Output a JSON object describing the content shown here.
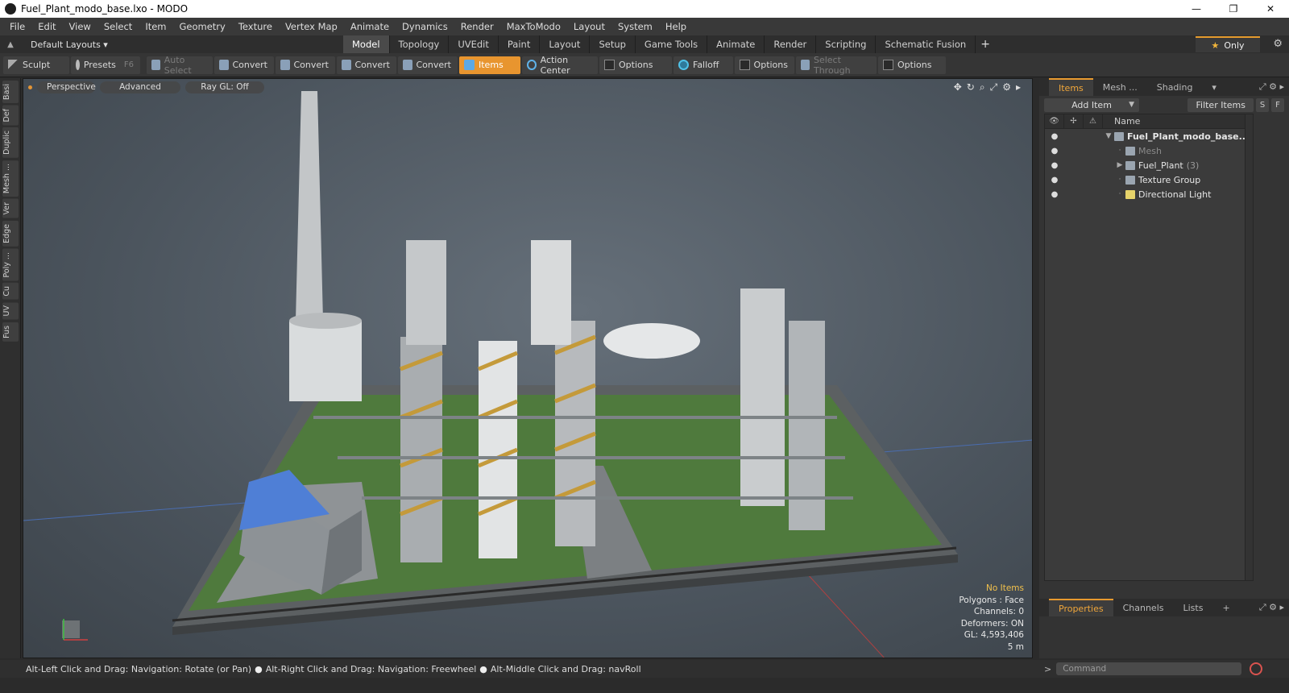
{
  "window": {
    "title": "Fuel_Plant_modo_base.lxo - MODO",
    "controls": [
      "—",
      "❐",
      "✕"
    ]
  },
  "menu": [
    "File",
    "Edit",
    "View",
    "Select",
    "Item",
    "Geometry",
    "Texture",
    "Vertex Map",
    "Animate",
    "Dynamics",
    "Render",
    "MaxToModo",
    "Layout",
    "System",
    "Help"
  ],
  "layout": {
    "layouts_label": "Default Layouts ▾",
    "tabs": [
      "Model",
      "Topology",
      "UVEdit",
      "Paint",
      "Layout",
      "Setup",
      "Game Tools",
      "Animate",
      "Render",
      "Scripting",
      "Schematic Fusion"
    ],
    "active_tab": "Model",
    "only_label": "Only"
  },
  "toolbar": {
    "sculpt": "Sculpt",
    "presets": "Presets",
    "presets_key": "F6",
    "auto_select": "Auto Select",
    "convert_1": "Convert",
    "convert_2": "Convert",
    "convert_3": "Convert",
    "convert_4": "Convert",
    "items": "Items",
    "action_center": "Action Center",
    "options_1": "Options",
    "falloff": "Falloff",
    "options_2": "Options",
    "select_through": "Select Through",
    "options_3": "Options"
  },
  "left_strip": [
    "Basi",
    "Def",
    "Duplic",
    "Mesh ...",
    "Ver",
    "Edge",
    "Poly ...",
    "Cu",
    "UV",
    "Fus"
  ],
  "viewport": {
    "view_mode": "Perspective",
    "shading": "Advanced",
    "raygl": "Ray GL: Off",
    "info": {
      "no_items": "No Items",
      "polygons": "Polygons : Face",
      "channels": "Channels: 0",
      "deformers": "Deformers: ON",
      "gl": "GL: 4,593,406",
      "scale": "5 m"
    }
  },
  "right_panel": {
    "tabs": [
      "Items",
      "Mesh ...",
      "Shading"
    ],
    "active_tab": "Items",
    "add_item": "Add Item",
    "filter_items": "Filter Items",
    "s_btn": "S",
    "f_btn": "F",
    "column_name": "Name",
    "items": [
      {
        "label": "Fuel_Plant_modo_base....",
        "count": "",
        "level": 0
      },
      {
        "label": "Mesh",
        "count": "",
        "level": 1
      },
      {
        "label": "Fuel_Plant",
        "count": "(3)",
        "level": 1
      },
      {
        "label": "Texture Group",
        "count": "",
        "level": 1
      },
      {
        "label": "Directional Light",
        "count": "",
        "level": 1
      }
    ],
    "bottom_tabs": [
      "Properties",
      "Channels",
      "Lists"
    ],
    "bottom_active": "Properties"
  },
  "status": {
    "hint_1": "Alt-Left Click and Drag: Navigation: Rotate (or Pan)",
    "hint_2": "Alt-Right Click and Drag: Navigation: Freewheel",
    "hint_3": "Alt-Middle Click and Drag: navRoll"
  },
  "command": {
    "placeholder": "Command"
  },
  "colors": {
    "accent": "#e8952f",
    "selected_tab": "#4a4a4a",
    "info_highlight": "#f2c14c"
  }
}
